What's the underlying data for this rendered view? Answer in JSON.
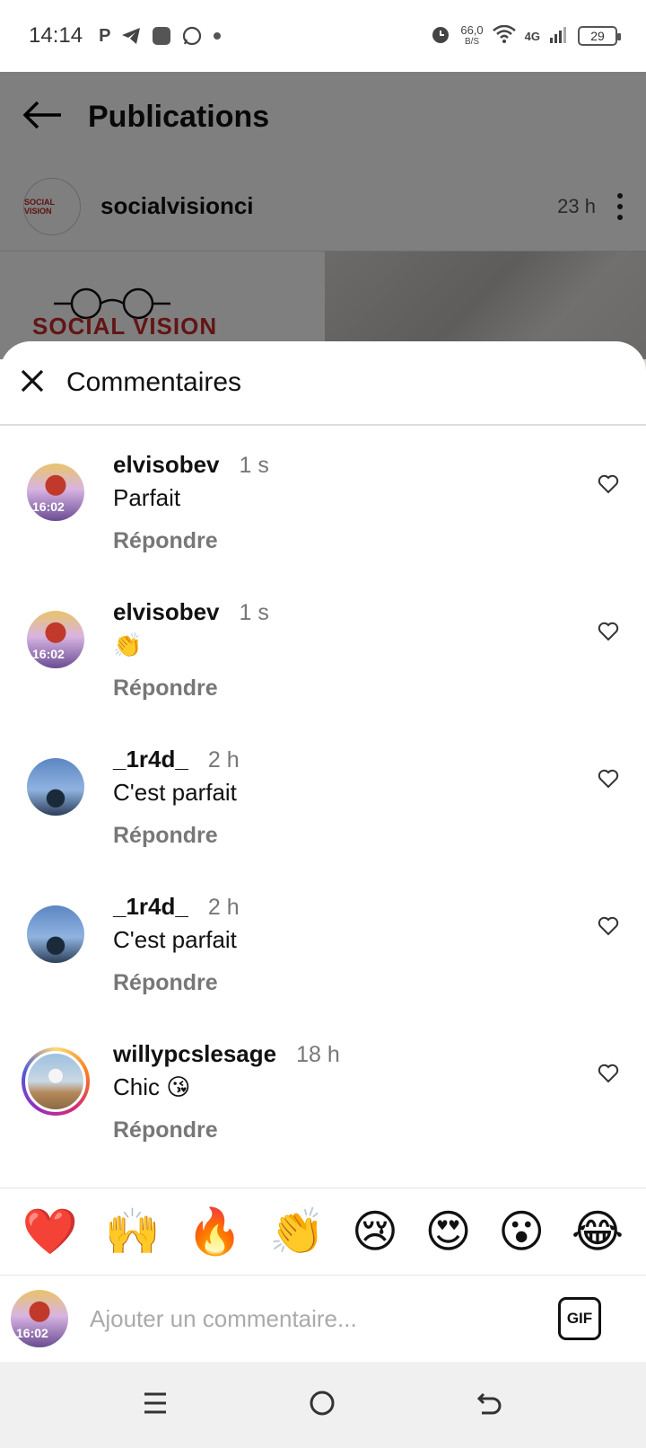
{
  "status_bar": {
    "time": "14:14",
    "net_speed_value": "66,0",
    "net_speed_unit": "B/S",
    "network": "4G",
    "battery": "29"
  },
  "background_page": {
    "title": "Publications",
    "post_user": "socialvisionci",
    "post_time": "23 h",
    "logo_text": "SOCIAL VISION",
    "avatar_text": "SOCIAL VISION"
  },
  "sheet": {
    "title": "Commentaires"
  },
  "comments": [
    {
      "user": "elvisobev",
      "time": "1 s",
      "text": "Parfait",
      "reply": "Répondre",
      "avatar": "elvis",
      "avatar_text": "16:02"
    },
    {
      "user": "elvisobev",
      "time": "1 s",
      "text": "👏",
      "reply": "Répondre",
      "avatar": "elvis",
      "avatar_text": "16:02"
    },
    {
      "user": "_1r4d_",
      "time": "2 h",
      "text": "C'est parfait",
      "reply": "Répondre",
      "avatar": "1r4d"
    },
    {
      "user": "_1r4d_",
      "time": "2 h",
      "text": "C'est parfait",
      "reply": "Répondre",
      "avatar": "1r4d"
    },
    {
      "user": "willypcslesage",
      "time": "18 h",
      "text": "Chic 😘",
      "reply": "Répondre",
      "avatar": "willy"
    }
  ],
  "emoji_bar": [
    "❤️",
    "🙌",
    "🔥",
    "👏",
    "😢",
    "😍",
    "😮",
    "😂"
  ],
  "input": {
    "placeholder": "Ajouter un commentaire...",
    "avatar_text": "16:02",
    "gif_label": "GIF"
  }
}
